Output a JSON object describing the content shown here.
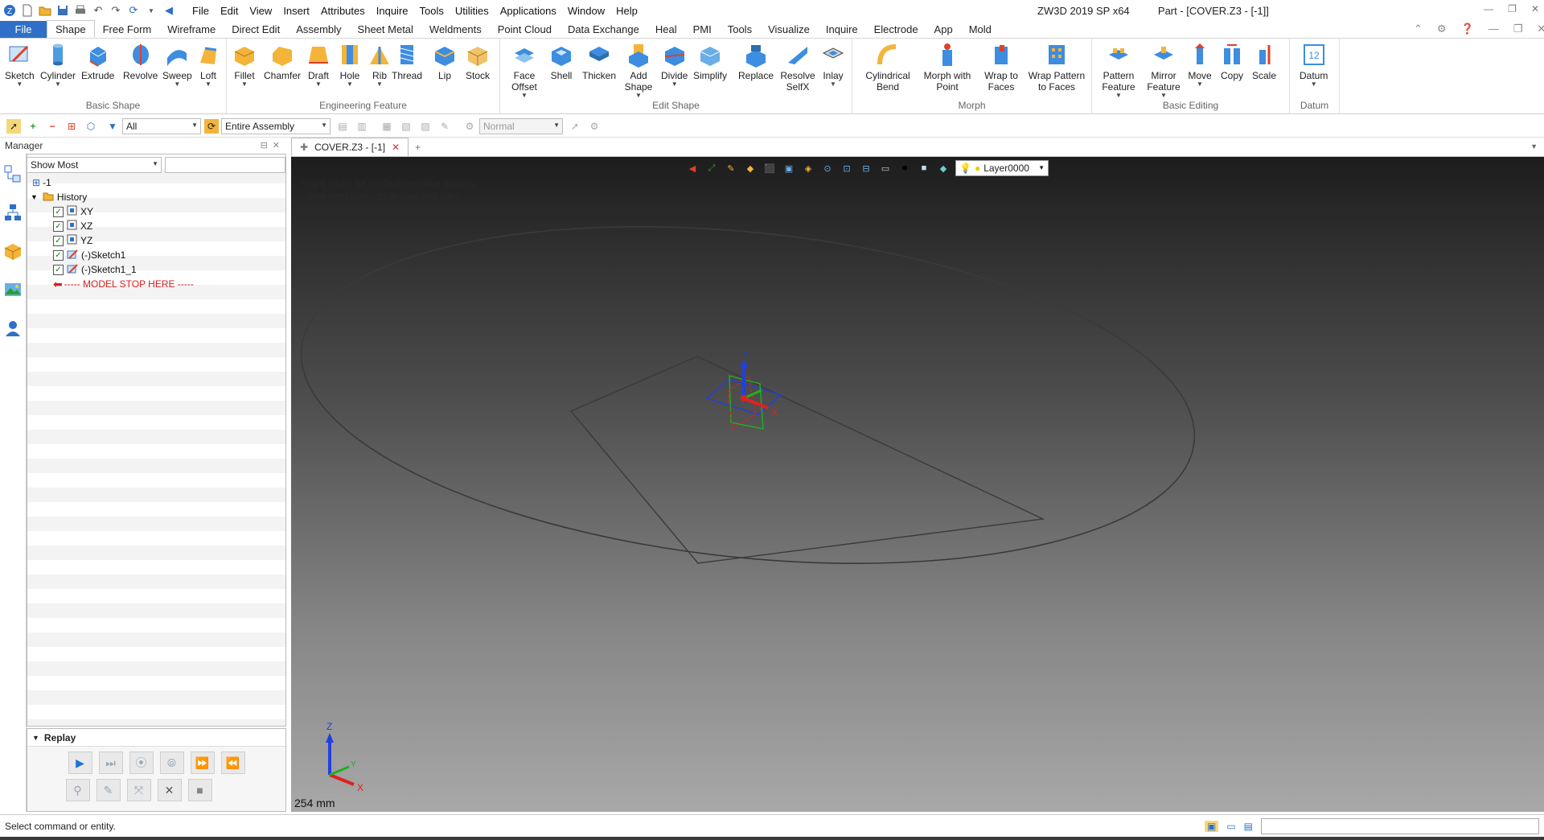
{
  "app": {
    "window_title": "ZW3D 2019 SP x64",
    "document_title": "Part - [COVER.Z3 - [-1]]",
    "menu": [
      "File",
      "Edit",
      "View",
      "Insert",
      "Attributes",
      "Inquire",
      "Tools",
      "Utilities",
      "Applications",
      "Window",
      "Help"
    ]
  },
  "ribbon": {
    "file_label": "File",
    "tabs": [
      "Shape",
      "Free Form",
      "Wireframe",
      "Direct Edit",
      "Assembly",
      "Sheet Metal",
      "Weldments",
      "Point Cloud",
      "Data Exchange",
      "Heal",
      "PMI",
      "Tools",
      "Visualize",
      "Inquire",
      "Electrode",
      "App",
      "Mold"
    ],
    "groups": [
      {
        "label": "Basic Shape",
        "buttons": [
          "Sketch",
          "Cylinder",
          "Extrude",
          "Revolve",
          "Sweep",
          "Loft"
        ]
      },
      {
        "label": "Engineering Feature",
        "buttons": [
          "Fillet",
          "Chamfer",
          "Draft",
          "Hole",
          "Rib",
          "Thread",
          "Lip",
          "Stock"
        ]
      },
      {
        "label": "Edit Shape",
        "buttons": [
          "Face Offset",
          "Shell",
          "Thicken",
          "Add Shape",
          "Divide",
          "Simplify",
          "Replace",
          "Resolve SelfX",
          "Inlay"
        ]
      },
      {
        "label": "Morph",
        "buttons": [
          "Cylindrical Bend",
          "Morph with Point",
          "Wrap to Faces",
          "Wrap Pattern to Faces"
        ]
      },
      {
        "label": "Basic Editing",
        "buttons": [
          "Pattern Feature",
          "Mirror Feature",
          "Move",
          "Copy",
          "Scale"
        ]
      },
      {
        "label": "Datum",
        "buttons": [
          "Datum"
        ]
      }
    ]
  },
  "filters": {
    "pick_filter": "All",
    "scope": "Entire Assembly",
    "mode": "Normal"
  },
  "manager": {
    "title": "Manager",
    "show_filter": "Show Most",
    "root": "-1",
    "history_label": "History",
    "items": [
      "XY",
      "XZ",
      "YZ",
      "(-)Sketch1",
      "(-)Sketch1_1"
    ],
    "stop_marker": "----- MODEL STOP HERE -----"
  },
  "replay": {
    "title": "Replay"
  },
  "document": {
    "tab_label": "COVER.Z3 - [-1]"
  },
  "viewport": {
    "hint_line1": "<right click> for context-sensitive options.",
    "hint_line2": "<Shift-right click> to display pick filter.",
    "layer": "Layer0000",
    "scale_label": "254 mm",
    "axis_z": "Z",
    "axis_x": "X",
    "axis_y": "Y"
  },
  "status": {
    "text": "Select command or entity."
  },
  "colors": {
    "accent": "#2f6fc7",
    "stop_marker": "#d21f1f",
    "triad_x": "#e02020",
    "triad_y": "#20b020",
    "triad_z": "#2040e0"
  }
}
